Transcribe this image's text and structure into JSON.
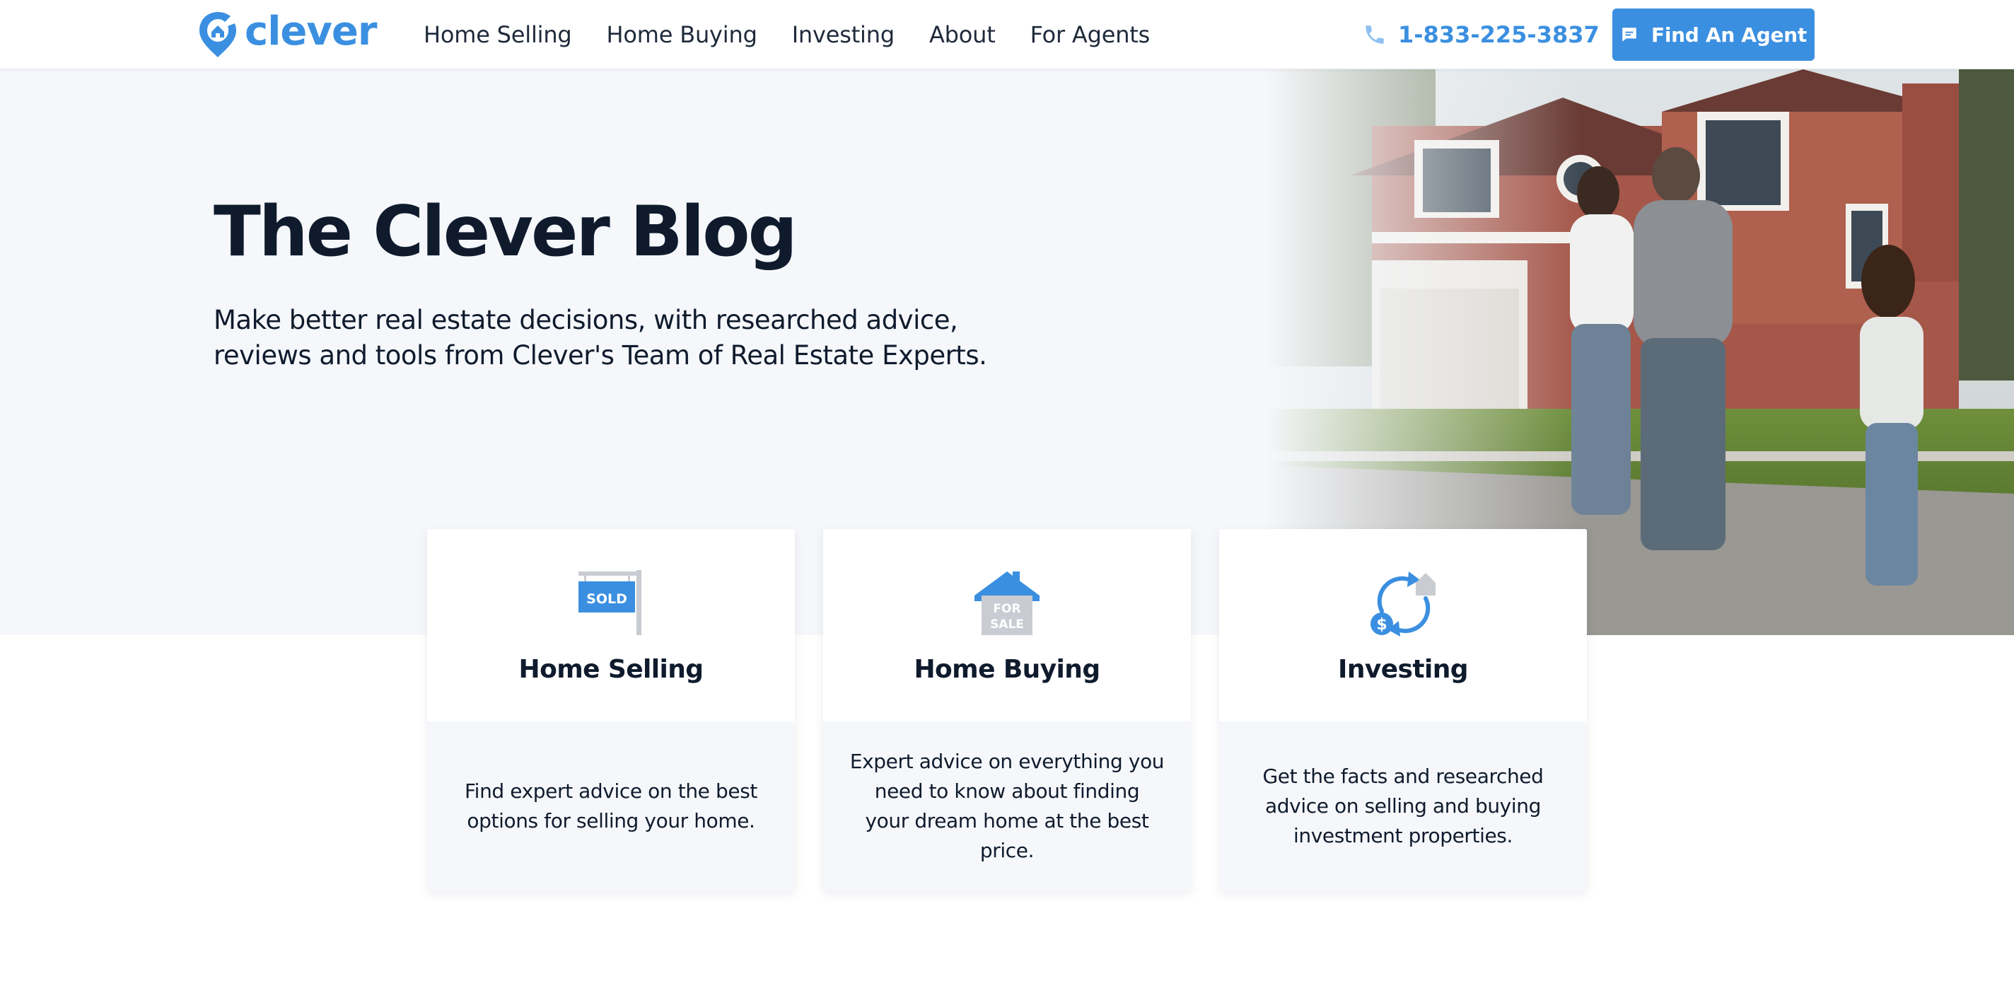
{
  "brand": {
    "name": "clever",
    "color": "#3b8fe0",
    "icon": "clever-pin-logo-icon"
  },
  "nav": {
    "links": [
      "Home Selling",
      "Home Buying",
      "Investing",
      "About",
      "For Agents"
    ],
    "phone": {
      "icon": "phone-icon",
      "text": "1-833-225-3837"
    },
    "cta": {
      "icon": "chat-bubble-icon",
      "label": "Find An Agent"
    }
  },
  "hero": {
    "title": "The Clever Blog",
    "subtitle_lines": [
      "Make better real estate decisions, with researched advice,",
      "reviews and tools from Clever's Team of Real Estate Experts."
    ],
    "image": "family-in-front-of-brick-house-photo"
  },
  "cards": [
    {
      "icon": "sold-sign-icon",
      "icon_text": "SOLD",
      "title": "Home Selling",
      "description_lines": [
        "Find expert advice on the best",
        "options for selling your home."
      ]
    },
    {
      "icon": "for-sale-house-icon",
      "icon_text": [
        "FOR",
        "SALE"
      ],
      "title": "Home Buying",
      "description_lines": [
        "Expert advice on everything you",
        "need to know about finding",
        "your dream home at the best",
        "price."
      ]
    },
    {
      "icon": "investing-cycle-icon",
      "icon_text": "$",
      "title": "Investing",
      "description_lines": [
        "Get the facts and researched",
        "advice on selling and buying",
        "investment properties."
      ]
    }
  ],
  "colors": {
    "accent": "#3b8fe0",
    "text": "#0f1b2d",
    "hero_bg": "#f5f7fa"
  }
}
